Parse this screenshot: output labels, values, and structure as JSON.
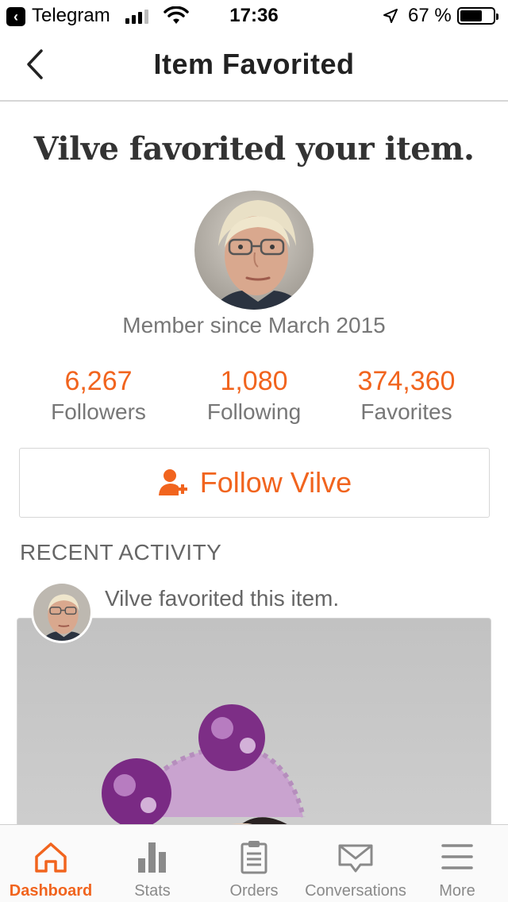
{
  "status_bar": {
    "back_app": "Telegram",
    "time": "17:36",
    "battery_percent": "67 %",
    "battery_level": 0.67,
    "signal_bars": 3
  },
  "nav": {
    "title": "Item Favorited",
    "back_icon": "chevron-left-icon"
  },
  "headline": "Vilve favorited your item.",
  "profile": {
    "member_since": "Member since March 2015",
    "stats": [
      {
        "value": "6,267",
        "label": "Followers"
      },
      {
        "value": "1,080",
        "label": "Following"
      },
      {
        "value": "374,360",
        "label": "Favorites"
      }
    ],
    "follow_button": "Follow Vilve",
    "follow_icon": "add-person-icon"
  },
  "recent_activity": {
    "heading": "RECENT ACTIVITY",
    "items": [
      {
        "text": "Vilve favorited this item."
      }
    ]
  },
  "tabs": [
    {
      "label": "Dashboard",
      "icon": "home-icon",
      "active": true
    },
    {
      "label": "Stats",
      "icon": "bar-chart-icon",
      "active": false
    },
    {
      "label": "Orders",
      "icon": "clipboard-icon",
      "active": false
    },
    {
      "label": "Conversations",
      "icon": "mail-icon",
      "active": false
    },
    {
      "label": "More",
      "icon": "menu-icon",
      "active": false
    }
  ],
  "colors": {
    "accent": "#f1641e",
    "muted_text": "#777777",
    "border": "#d6d6d6"
  }
}
